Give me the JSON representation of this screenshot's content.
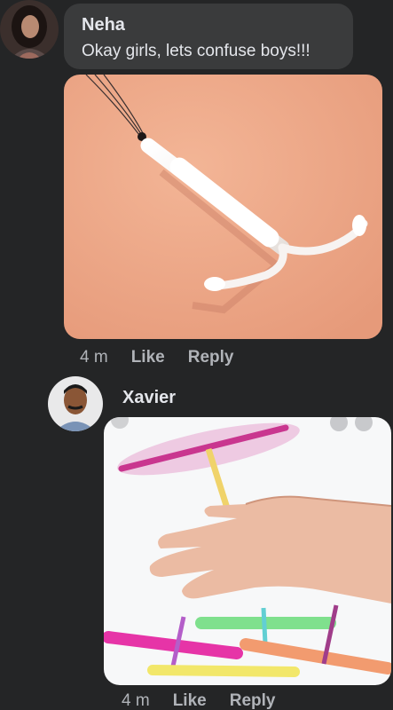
{
  "comments": [
    {
      "author": "Neha",
      "text": "Okay girls, lets confuse boys!!!",
      "time": "4 m",
      "like_label": "Like",
      "reply_label": "Reply",
      "image_desc": "iud-photo"
    },
    {
      "author": "Xavier",
      "time": "4 m",
      "like_label": "Like",
      "reply_label": "Reply",
      "image_desc": "bamboo-copter-toy-photo"
    }
  ],
  "colors": {
    "background": "#242526",
    "bubble": "#3a3b3c",
    "text": "#e4e6eb",
    "meta": "#b0b3b8"
  }
}
